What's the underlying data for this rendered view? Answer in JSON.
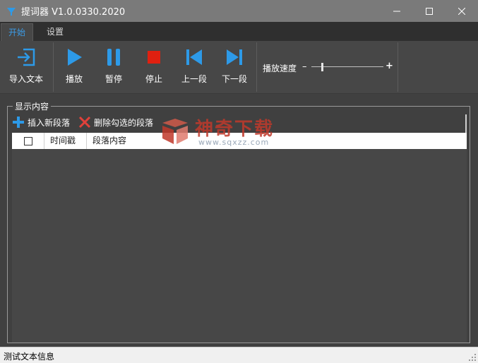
{
  "window": {
    "title": "提词器 V1.0.0330.2020"
  },
  "tabs": [
    {
      "label": "开始",
      "active": true
    },
    {
      "label": "设置",
      "active": false
    }
  ],
  "toolbar": {
    "import": {
      "label": "导入文本",
      "icon": "import-icon"
    },
    "play": {
      "label": "播放",
      "icon": "play-icon"
    },
    "pause": {
      "label": "暂停",
      "icon": "pause-icon"
    },
    "stop": {
      "label": "停止",
      "icon": "stop-icon"
    },
    "prev": {
      "label": "上一段",
      "icon": "skip-previous-icon"
    },
    "next": {
      "label": "下一段",
      "icon": "skip-next-icon"
    },
    "speed": {
      "label": "播放速度",
      "minus": "–",
      "plus": "+",
      "value_fraction": 0.14
    }
  },
  "content_group": {
    "legend": "显示内容",
    "actions": {
      "insert": {
        "label": "插入新段落",
        "icon": "plus-icon"
      },
      "delete": {
        "label": "删除勾选的段落",
        "icon": "x-icon"
      }
    },
    "table": {
      "columns": [
        "时间戳",
        "段落内容"
      ],
      "rows": []
    }
  },
  "watermark": {
    "text": "神奇下载",
    "url": "www.sqxzz.com"
  },
  "statusbar": {
    "text": "测试文本信息"
  },
  "colors": {
    "accent": "#2d9ae8",
    "stop": "#e02010",
    "delete": "#e0413a"
  }
}
